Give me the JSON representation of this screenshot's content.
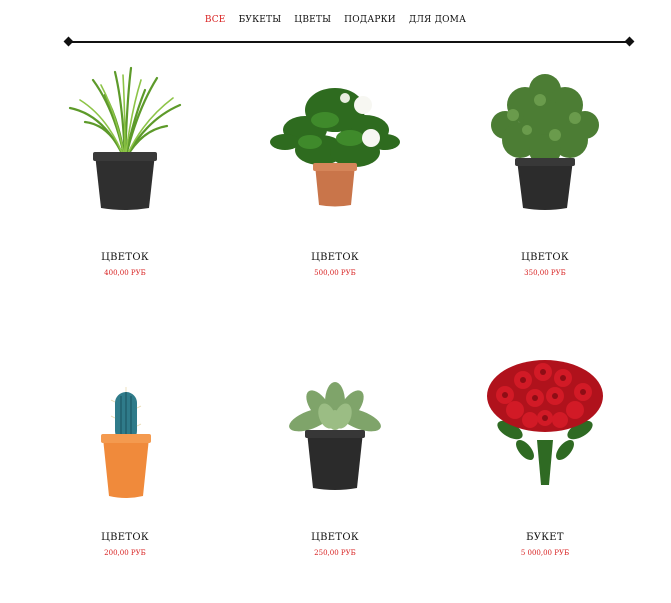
{
  "nav": {
    "items": [
      {
        "label": "ВСЕ",
        "active": true
      },
      {
        "label": "БУКЕТЫ",
        "active": false
      },
      {
        "label": "ЦВЕТЫ",
        "active": false
      },
      {
        "label": "ПОДАРКИ",
        "active": false
      },
      {
        "label": "ДЛЯ ДОМА",
        "active": false
      }
    ],
    "active_color": "#d81f1f"
  },
  "products": [
    {
      "name": "ЦВЕТОК",
      "price": "400,00 РУБ",
      "icon": "grass-plant-icon"
    },
    {
      "name": "ЦВЕТОК",
      "price": "500,00 РУБ",
      "icon": "gardenia-plant-icon"
    },
    {
      "name": "ЦВЕТОК",
      "price": "350,00 РУБ",
      "icon": "herb-plant-icon"
    },
    {
      "name": "ЦВЕТОК",
      "price": "200,00 РУБ",
      "icon": "cactus-plant-icon"
    },
    {
      "name": "ЦВЕТОК",
      "price": "250,00 РУБ",
      "icon": "succulent-plant-icon"
    },
    {
      "name": "БУКЕТ",
      "price": "5 000,00 РУБ",
      "icon": "rose-bouquet-icon"
    }
  ],
  "price_color": "#d81f1f"
}
